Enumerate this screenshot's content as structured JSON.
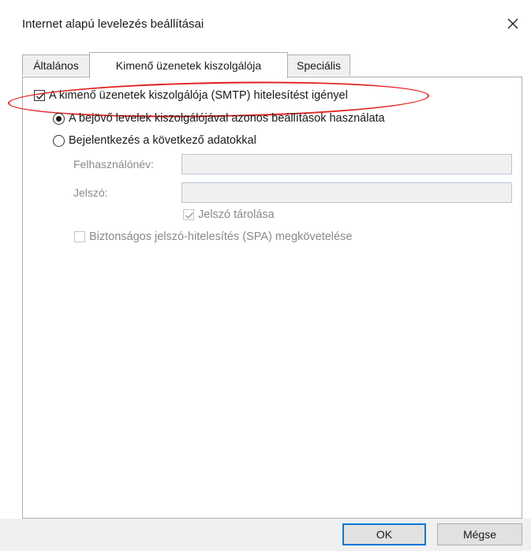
{
  "dialog": {
    "title": "Internet alapú levelezés beállításai"
  },
  "tabs": [
    {
      "label": "Általános"
    },
    {
      "label": "Kimenő üzenetek kiszolgálója"
    },
    {
      "label": "Speciális"
    }
  ],
  "outgoing": {
    "require_auth_label": "A kimenő üzenetek kiszolgálója (SMTP) hitelesítést igényel",
    "require_auth_checked": true,
    "use_same_settings_label": "A bejövő levelek kiszolgálójával azonos beállítások használata",
    "use_same_settings_selected": true,
    "log_on_using_label": "Bejelentkezés a következő adatokkal",
    "log_on_using_selected": false,
    "username_label": "Felhasználónév:",
    "username_value": "",
    "password_label": "Jelszó:",
    "password_value": "",
    "remember_password_label": "Jelszó tárolása",
    "remember_password_checked": true,
    "spa_label": "Biztonságos jelszó-hitelesítés (SPA) megkövetelése",
    "spa_checked": false
  },
  "buttons": {
    "ok": "OK",
    "cancel": "Mégse"
  },
  "colors": {
    "annotation": "#e0201c",
    "default_button_border": "#0078d7"
  },
  "icons": {
    "close": "close-icon",
    "check": "checkmark-icon"
  }
}
